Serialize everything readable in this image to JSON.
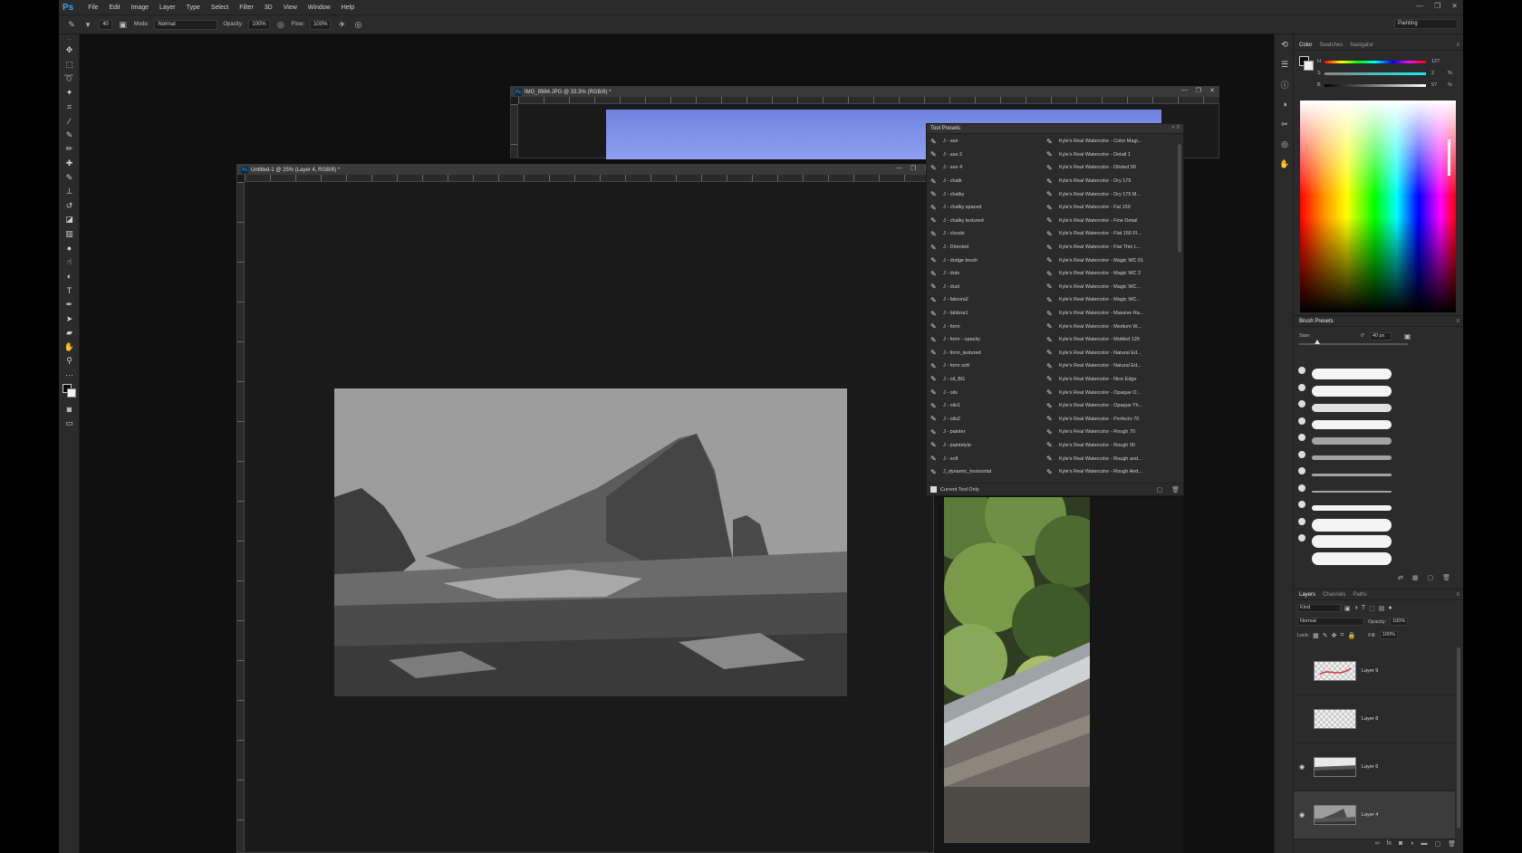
{
  "app": {
    "logo": "Ps"
  },
  "menu": [
    "File",
    "Edit",
    "Image",
    "Layer",
    "Type",
    "Select",
    "Filter",
    "3D",
    "View",
    "Window",
    "Help"
  ],
  "options": {
    "brush_size": "40",
    "mode_label": "Mode:",
    "mode_value": "Normal",
    "opacity_label": "Opacity:",
    "opacity_value": "100%",
    "flow_label": "Flow:",
    "flow_value": "100%",
    "workspace": "Painting"
  },
  "documents": {
    "back_title": "IMG_8984.JPG @ 33.3% (RGB/8) *",
    "front_title": "Untitled-1 @ 25% (Layer 4, RGB/8) *"
  },
  "tool_presets": {
    "title": "Tool Presets",
    "left": [
      "J - axe",
      "J - axe 2",
      "J - axe 4",
      "J - chalk",
      "J - chalky",
      "J - chalky spaced",
      "J - chalky textured",
      "J - clouds",
      "J - Directed",
      "J - dodge brush",
      "J - dots",
      "J - dust",
      "J - fakrura2",
      "J - faldura1",
      "J - form",
      "J - form - opacity",
      "J - form_textured",
      "J - form soft",
      "J - oil_BG",
      "J - oils",
      "J - oils1",
      "J - oils2",
      "J - painter",
      "J - paintstyle",
      "J - soft",
      "J_dynamic_horizontal"
    ],
    "right": [
      "Kyle's Real Watercolor - Color Magi...",
      "Kyle's Real Watercolor - Detail 1",
      "Kyle's Real Watercolor - Diluted 90",
      "Kyle's Real Watercolor - Dry 175",
      "Kyle's Real Watercolor - Dry 175 M...",
      "Kyle's Real Watercolor - Fat 150",
      "Kyle's Real Watercolor - Fine Detail",
      "Kyle's Real Watercolor - Flat 150 Fl...",
      "Kyle's Real Watercolor - Flat Thin L...",
      "Kyle's Real Watercolor - Magic WC 01",
      "Kyle's Real Watercolor - Magic WC 2",
      "Kyle's Real Watercolor - Magic WC...",
      "Kyle's Real Watercolor - Magic WC...",
      "Kyle's Real Watercolor - Massive Ra...",
      "Kyle's Real Watercolor - Medium W...",
      "Kyle's Real Watercolor - Mottled 126",
      "Kyle's Real Watercolor - Natural Ed...",
      "Kyle's Real Watercolor - Natural Ed...",
      "Kyle's Real Watercolor - Nice Edge",
      "Kyle's Real Watercolor - Opaque O...",
      "Kyle's Real Watercolor - Opaque Th...",
      "Kyle's Real Watercolor - Perfecto 70",
      "Kyle's Real Watercolor - Rough 70",
      "Kyle's Real Watercolor - Rough 90",
      "Kyle's Real Watercolor - Rough and...",
      "Kyle's Real Watercolor - Rough And..."
    ],
    "current_tool_only": "Current Tool Only"
  },
  "color_panel": {
    "tabs": [
      "Color",
      "Swatches",
      "Navigator"
    ],
    "h_label": "H",
    "h_value": "127",
    "s_label": "S",
    "s_value": "2",
    "b_label": "B",
    "b_value": "57",
    "pct": "%"
  },
  "brush_presets": {
    "title": "Brush Presets",
    "size_label": "Size:",
    "size_value": "40 px",
    "size_fraction": 0.17
  },
  "layers_panel": {
    "tabs": [
      "Layers",
      "Channels",
      "Paths"
    ],
    "kind": "Kind",
    "blend_mode": "Normal",
    "opacity_label": "Opacity:",
    "opacity_value": "100%",
    "lock_label": "Lock:",
    "fill_label": "Fill:",
    "fill_value": "100%",
    "layers": [
      {
        "name": "Layer 9",
        "visible": false,
        "selected": false
      },
      {
        "name": "Layer 8",
        "visible": false,
        "selected": false
      },
      {
        "name": "Layer 6",
        "visible": true,
        "selected": false
      },
      {
        "name": "Layer 4",
        "visible": true,
        "selected": true
      }
    ]
  },
  "icons": {
    "brush": "brush-icon",
    "eye": "eye-icon"
  }
}
